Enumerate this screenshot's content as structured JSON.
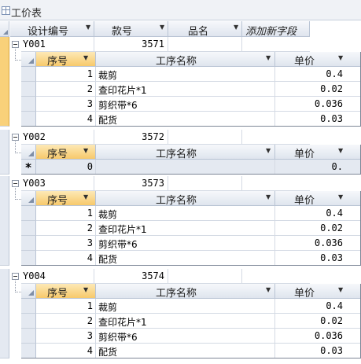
{
  "window": {
    "title": "工价表"
  },
  "main_headers": [
    "设计编号",
    "款号",
    "品名",
    "添加新字段"
  ],
  "sub_headers": [
    "序号",
    "工序名称",
    "单价"
  ],
  "records": [
    {
      "design_no": "Y001",
      "style_no": "3571",
      "name": "",
      "selected": true,
      "rows": [
        {
          "seq": "1",
          "process": "裁剪",
          "price": "0.4"
        },
        {
          "seq": "2",
          "process": "查印花片*1",
          "price": "0.02"
        },
        {
          "seq": "3",
          "process": "剪织带*6",
          "price": "0.036"
        },
        {
          "seq": "4",
          "process": "配货",
          "price": "0.03"
        }
      ],
      "new_row": null
    },
    {
      "design_no": "Y002",
      "style_no": "3572",
      "name": "",
      "selected": false,
      "rows": [],
      "new_row": {
        "marker": "*",
        "seq": "0",
        "price": "0."
      }
    },
    {
      "design_no": "Y003",
      "style_no": "3573",
      "name": "",
      "selected": false,
      "rows": [
        {
          "seq": "1",
          "process": "裁剪",
          "price": "0.4"
        },
        {
          "seq": "2",
          "process": "查印花片*1",
          "price": "0.02"
        },
        {
          "seq": "3",
          "process": "剪织带*6",
          "price": "0.036"
        },
        {
          "seq": "4",
          "process": "配货",
          "price": "0.03"
        }
      ],
      "new_row": null
    },
    {
      "design_no": "Y004",
      "style_no": "3574",
      "name": "",
      "selected": false,
      "rows": [
        {
          "seq": "1",
          "process": "裁剪",
          "price": "0.4"
        },
        {
          "seq": "2",
          "process": "查印花片*1",
          "price": "0.02"
        },
        {
          "seq": "3",
          "process": "剪织带*6",
          "price": "0.036"
        },
        {
          "seq": "4",
          "process": "配货",
          "price": "0.03"
        }
      ],
      "new_row": null
    }
  ],
  "icons": {
    "table": "table-icon",
    "dropdown": "dropdown-arrow-icon",
    "collapse": "collapse-minus-icon",
    "select_all": "select-all-icon"
  }
}
